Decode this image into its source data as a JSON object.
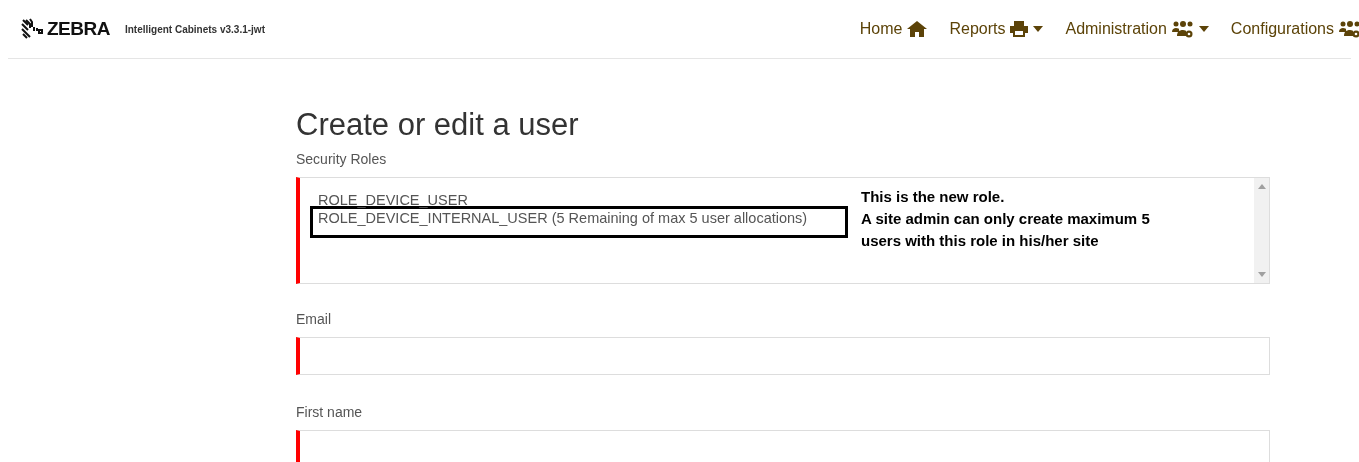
{
  "brand": {
    "logo": "ZEBRA",
    "product": "Intelligent Cabinets v3.3.1-jwt"
  },
  "nav": [
    {
      "label": "Home",
      "kind": "home",
      "caret": false
    },
    {
      "label": "Reports",
      "kind": "reports",
      "caret": true
    },
    {
      "label": "Administration",
      "kind": "admin",
      "caret": true
    },
    {
      "label": "Configurations",
      "kind": "admin",
      "caret": false
    }
  ],
  "page_title": "Create or edit a user",
  "roles": {
    "label": "Security Roles",
    "options": [
      {
        "label": "ROLE_DEVICE_USER",
        "highlighted": false
      },
      {
        "label": "ROLE_DEVICE_INTERNAL_USER (5 Remaining of max 5 user allocations)",
        "highlighted": true
      }
    ],
    "annotation": "This is the new role.\nA site admin can only create maximum 5\nusers with this role in his/her site"
  },
  "fields": [
    {
      "label": "Email"
    },
    {
      "label": "First name"
    }
  ]
}
